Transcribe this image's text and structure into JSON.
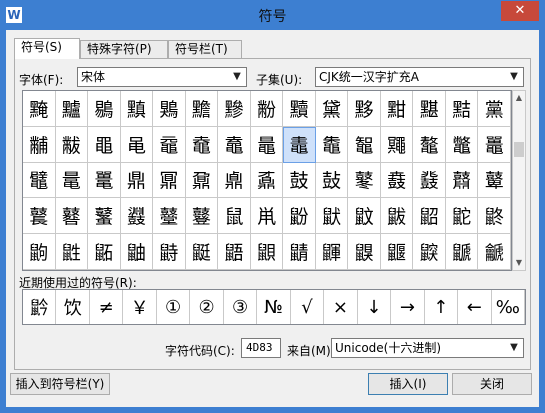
{
  "window": {
    "title": "符号",
    "app_icon": "W",
    "close": "✕"
  },
  "tabs": [
    {
      "label": "符号(S)"
    },
    {
      "label": "特殊字符(P)"
    },
    {
      "label": "符号栏(T)"
    }
  ],
  "font": {
    "label": "字体(F):",
    "value": "宋体"
  },
  "subset": {
    "label": "子集(U):",
    "value": "CJK统一汉字扩充A"
  },
  "symbols": [
    [
      "黤",
      "黸",
      "鶍",
      "黰",
      "鶪",
      "黵",
      "黲",
      "黺",
      "黷",
      "黛",
      "黟",
      "黚",
      "黮",
      "黠",
      "黨"
    ],
    [
      "黼",
      "黻",
      "黽",
      "黾",
      "黿",
      "鼀",
      "鼁",
      "鼂",
      "鼃",
      "鼄",
      "鼅",
      "鼆",
      "鼇",
      "鼈",
      "鼉"
    ],
    [
      "鼊",
      "鼌",
      "鼍",
      "鼎",
      "鼏",
      "鼐",
      "鼑",
      "鼒",
      "鼓",
      "鼔",
      "鼕",
      "鼖",
      "鼗",
      "鼘",
      "鼙"
    ],
    [
      "鼚",
      "鼛",
      "鼜",
      "鼝",
      "鼞",
      "鼟",
      "鼠",
      "鼡",
      "鼢",
      "鼣",
      "鼤",
      "鼥",
      "鼦",
      "鼧",
      "鼨"
    ],
    [
      "鼩",
      "鼪",
      "鼫",
      "鼬",
      "鼭",
      "鼮",
      "鼯",
      "鼰",
      "鼱",
      "鼲",
      "鼳",
      "鼴",
      "鼵",
      "鼶",
      "䶵"
    ]
  ],
  "recent": {
    "label": "近期使用过的符号(R):",
    "items": [
      "䶃",
      "饮",
      "≠",
      "￥",
      "①",
      "②",
      "③",
      "№",
      "√",
      "×",
      "↓",
      "→",
      "↑",
      "←",
      "‰"
    ]
  },
  "char_code": {
    "label": "字符代码(C):",
    "value": "4D83"
  },
  "from": {
    "label": "来自(M)",
    "value": "Unicode(十六进制)"
  },
  "buttons": {
    "insert_to_bar": "插入到符号栏(Y)",
    "insert": "插入(I)",
    "close": "关闭"
  }
}
